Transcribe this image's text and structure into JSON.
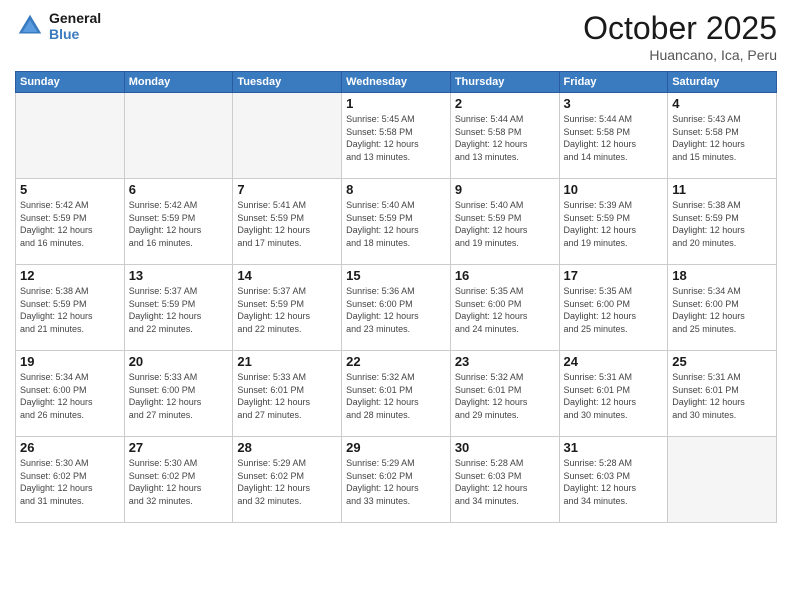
{
  "header": {
    "logo_general": "General",
    "logo_blue": "Blue",
    "month_title": "October 2025",
    "location": "Huancano, Ica, Peru"
  },
  "weekdays": [
    "Sunday",
    "Monday",
    "Tuesday",
    "Wednesday",
    "Thursday",
    "Friday",
    "Saturday"
  ],
  "weeks": [
    [
      {
        "day": "",
        "info": ""
      },
      {
        "day": "",
        "info": ""
      },
      {
        "day": "",
        "info": ""
      },
      {
        "day": "1",
        "info": "Sunrise: 5:45 AM\nSunset: 5:58 PM\nDaylight: 12 hours\nand 13 minutes."
      },
      {
        "day": "2",
        "info": "Sunrise: 5:44 AM\nSunset: 5:58 PM\nDaylight: 12 hours\nand 13 minutes."
      },
      {
        "day": "3",
        "info": "Sunrise: 5:44 AM\nSunset: 5:58 PM\nDaylight: 12 hours\nand 14 minutes."
      },
      {
        "day": "4",
        "info": "Sunrise: 5:43 AM\nSunset: 5:58 PM\nDaylight: 12 hours\nand 15 minutes."
      }
    ],
    [
      {
        "day": "5",
        "info": "Sunrise: 5:42 AM\nSunset: 5:59 PM\nDaylight: 12 hours\nand 16 minutes."
      },
      {
        "day": "6",
        "info": "Sunrise: 5:42 AM\nSunset: 5:59 PM\nDaylight: 12 hours\nand 16 minutes."
      },
      {
        "day": "7",
        "info": "Sunrise: 5:41 AM\nSunset: 5:59 PM\nDaylight: 12 hours\nand 17 minutes."
      },
      {
        "day": "8",
        "info": "Sunrise: 5:40 AM\nSunset: 5:59 PM\nDaylight: 12 hours\nand 18 minutes."
      },
      {
        "day": "9",
        "info": "Sunrise: 5:40 AM\nSunset: 5:59 PM\nDaylight: 12 hours\nand 19 minutes."
      },
      {
        "day": "10",
        "info": "Sunrise: 5:39 AM\nSunset: 5:59 PM\nDaylight: 12 hours\nand 19 minutes."
      },
      {
        "day": "11",
        "info": "Sunrise: 5:38 AM\nSunset: 5:59 PM\nDaylight: 12 hours\nand 20 minutes."
      }
    ],
    [
      {
        "day": "12",
        "info": "Sunrise: 5:38 AM\nSunset: 5:59 PM\nDaylight: 12 hours\nand 21 minutes."
      },
      {
        "day": "13",
        "info": "Sunrise: 5:37 AM\nSunset: 5:59 PM\nDaylight: 12 hours\nand 22 minutes."
      },
      {
        "day": "14",
        "info": "Sunrise: 5:37 AM\nSunset: 5:59 PM\nDaylight: 12 hours\nand 22 minutes."
      },
      {
        "day": "15",
        "info": "Sunrise: 5:36 AM\nSunset: 6:00 PM\nDaylight: 12 hours\nand 23 minutes."
      },
      {
        "day": "16",
        "info": "Sunrise: 5:35 AM\nSunset: 6:00 PM\nDaylight: 12 hours\nand 24 minutes."
      },
      {
        "day": "17",
        "info": "Sunrise: 5:35 AM\nSunset: 6:00 PM\nDaylight: 12 hours\nand 25 minutes."
      },
      {
        "day": "18",
        "info": "Sunrise: 5:34 AM\nSunset: 6:00 PM\nDaylight: 12 hours\nand 25 minutes."
      }
    ],
    [
      {
        "day": "19",
        "info": "Sunrise: 5:34 AM\nSunset: 6:00 PM\nDaylight: 12 hours\nand 26 minutes."
      },
      {
        "day": "20",
        "info": "Sunrise: 5:33 AM\nSunset: 6:00 PM\nDaylight: 12 hours\nand 27 minutes."
      },
      {
        "day": "21",
        "info": "Sunrise: 5:33 AM\nSunset: 6:01 PM\nDaylight: 12 hours\nand 27 minutes."
      },
      {
        "day": "22",
        "info": "Sunrise: 5:32 AM\nSunset: 6:01 PM\nDaylight: 12 hours\nand 28 minutes."
      },
      {
        "day": "23",
        "info": "Sunrise: 5:32 AM\nSunset: 6:01 PM\nDaylight: 12 hours\nand 29 minutes."
      },
      {
        "day": "24",
        "info": "Sunrise: 5:31 AM\nSunset: 6:01 PM\nDaylight: 12 hours\nand 30 minutes."
      },
      {
        "day": "25",
        "info": "Sunrise: 5:31 AM\nSunset: 6:01 PM\nDaylight: 12 hours\nand 30 minutes."
      }
    ],
    [
      {
        "day": "26",
        "info": "Sunrise: 5:30 AM\nSunset: 6:02 PM\nDaylight: 12 hours\nand 31 minutes."
      },
      {
        "day": "27",
        "info": "Sunrise: 5:30 AM\nSunset: 6:02 PM\nDaylight: 12 hours\nand 32 minutes."
      },
      {
        "day": "28",
        "info": "Sunrise: 5:29 AM\nSunset: 6:02 PM\nDaylight: 12 hours\nand 32 minutes."
      },
      {
        "day": "29",
        "info": "Sunrise: 5:29 AM\nSunset: 6:02 PM\nDaylight: 12 hours\nand 33 minutes."
      },
      {
        "day": "30",
        "info": "Sunrise: 5:28 AM\nSunset: 6:03 PM\nDaylight: 12 hours\nand 34 minutes."
      },
      {
        "day": "31",
        "info": "Sunrise: 5:28 AM\nSunset: 6:03 PM\nDaylight: 12 hours\nand 34 minutes."
      },
      {
        "day": "",
        "info": ""
      }
    ]
  ]
}
